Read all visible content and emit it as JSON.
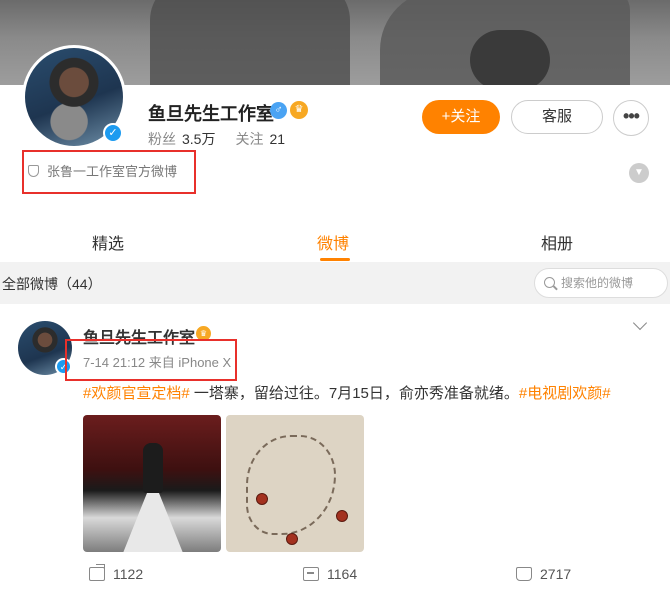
{
  "profile": {
    "name": "鱼旦先生工作室",
    "gender_icon": "male-icon",
    "vip_icon": "crown-icon",
    "followers_label": "粉丝",
    "followers_value": "3.5万",
    "following_label": "关注",
    "following_value": "21",
    "follow_button": "关注",
    "follow_plus": "+",
    "service_button": "客服",
    "more_button": "•••",
    "description": "张鲁一工作室官方微博",
    "verified_mark": "✓"
  },
  "tabs": [
    {
      "label": "精选"
    },
    {
      "label": "微博",
      "active": true
    },
    {
      "label": "相册"
    }
  ],
  "filter": {
    "label": "全部微博（44）",
    "search_placeholder": "搜索他的微博"
  },
  "post": {
    "author": "鱼旦先生工作室",
    "time": "7-14 21:12",
    "source": "来自 iPhone X",
    "hashtag1": "#欢颜官宣定档#",
    "body": " 一塔寨，留给过往。7月15日，俞亦秀准备就绪。",
    "hashtag2": "#电视剧欢颜#",
    "reposts": "1122",
    "comments": "1164",
    "likes": "2717"
  },
  "colors": {
    "accent": "#ff8200",
    "highlight_box": "#e8302b",
    "verified": "#1d9bf0"
  }
}
